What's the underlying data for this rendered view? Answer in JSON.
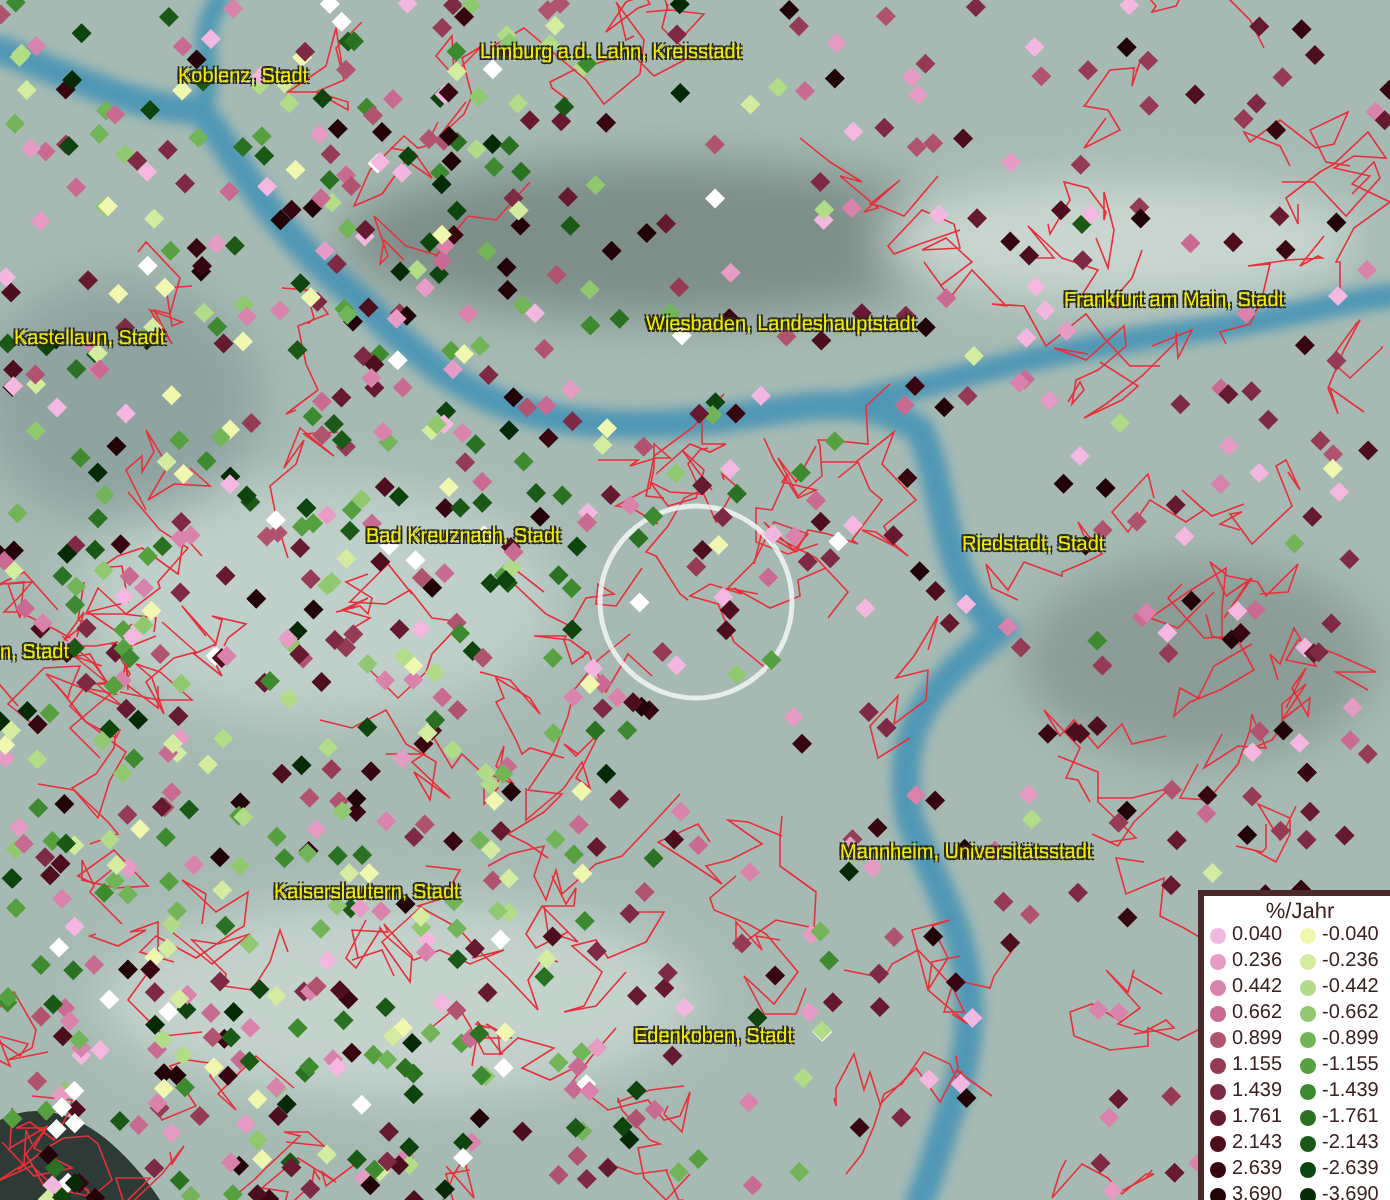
{
  "map": {
    "place_labels": [
      "Limburg a.d. Lahn, Kreisstadt",
      "Koblenz, Stadt",
      "Kastellaun, Stadt",
      "Wiesbaden, Landeshauptstadt",
      "Frankfurt am Main, Stadt",
      "Bad Kreuznach, Stadt",
      "Riedstadt, Stadt",
      "n, Stadt",
      "Mannheim, Universitätsstadt",
      "Kaiserslautern, Stadt",
      "Edenkoben, Stadt"
    ]
  },
  "legend": {
    "title": "%/Jahr",
    "rows": [
      {
        "positive": {
          "label": "0.040",
          "color": "#f4b8e0"
        },
        "negative": {
          "label": "-0.040",
          "color": "#f0f8b0"
        }
      },
      {
        "positive": {
          "label": "0.236",
          "color": "#e79cc6"
        },
        "negative": {
          "label": "-0.236",
          "color": "#d4eca0"
        }
      },
      {
        "positive": {
          "label": "0.442",
          "color": "#d982ac"
        },
        "negative": {
          "label": "-0.442",
          "color": "#b2dc88"
        }
      },
      {
        "positive": {
          "label": "0.662",
          "color": "#c86a92"
        },
        "negative": {
          "label": "-0.662",
          "color": "#90c870"
        }
      },
      {
        "positive": {
          "label": "0.899",
          "color": "#b0536f"
        },
        "negative": {
          "label": "-0.899",
          "color": "#72b458"
        }
      },
      {
        "positive": {
          "label": "1.155",
          "color": "#963b56"
        },
        "negative": {
          "label": "-1.155",
          "color": "#56a040"
        }
      },
      {
        "positive": {
          "label": "1.439",
          "color": "#7e2a44"
        },
        "negative": {
          "label": "-1.439",
          "color": "#3e8a30"
        }
      },
      {
        "positive": {
          "label": "1.761",
          "color": "#661a30"
        },
        "negative": {
          "label": "-1.761",
          "color": "#2a7222"
        }
      },
      {
        "positive": {
          "label": "2.143",
          "color": "#4d0e1e"
        },
        "negative": {
          "label": "-2.143",
          "color": "#1a5a16"
        }
      },
      {
        "positive": {
          "label": "2.639",
          "color": "#380610"
        },
        "negative": {
          "label": "-2.639",
          "color": "#0e440e"
        }
      },
      {
        "positive": {
          "label": "3.690",
          "color": "#220308"
        },
        "negative": {
          "label": "-3.690",
          "color": "#062a06"
        }
      }
    ]
  }
}
